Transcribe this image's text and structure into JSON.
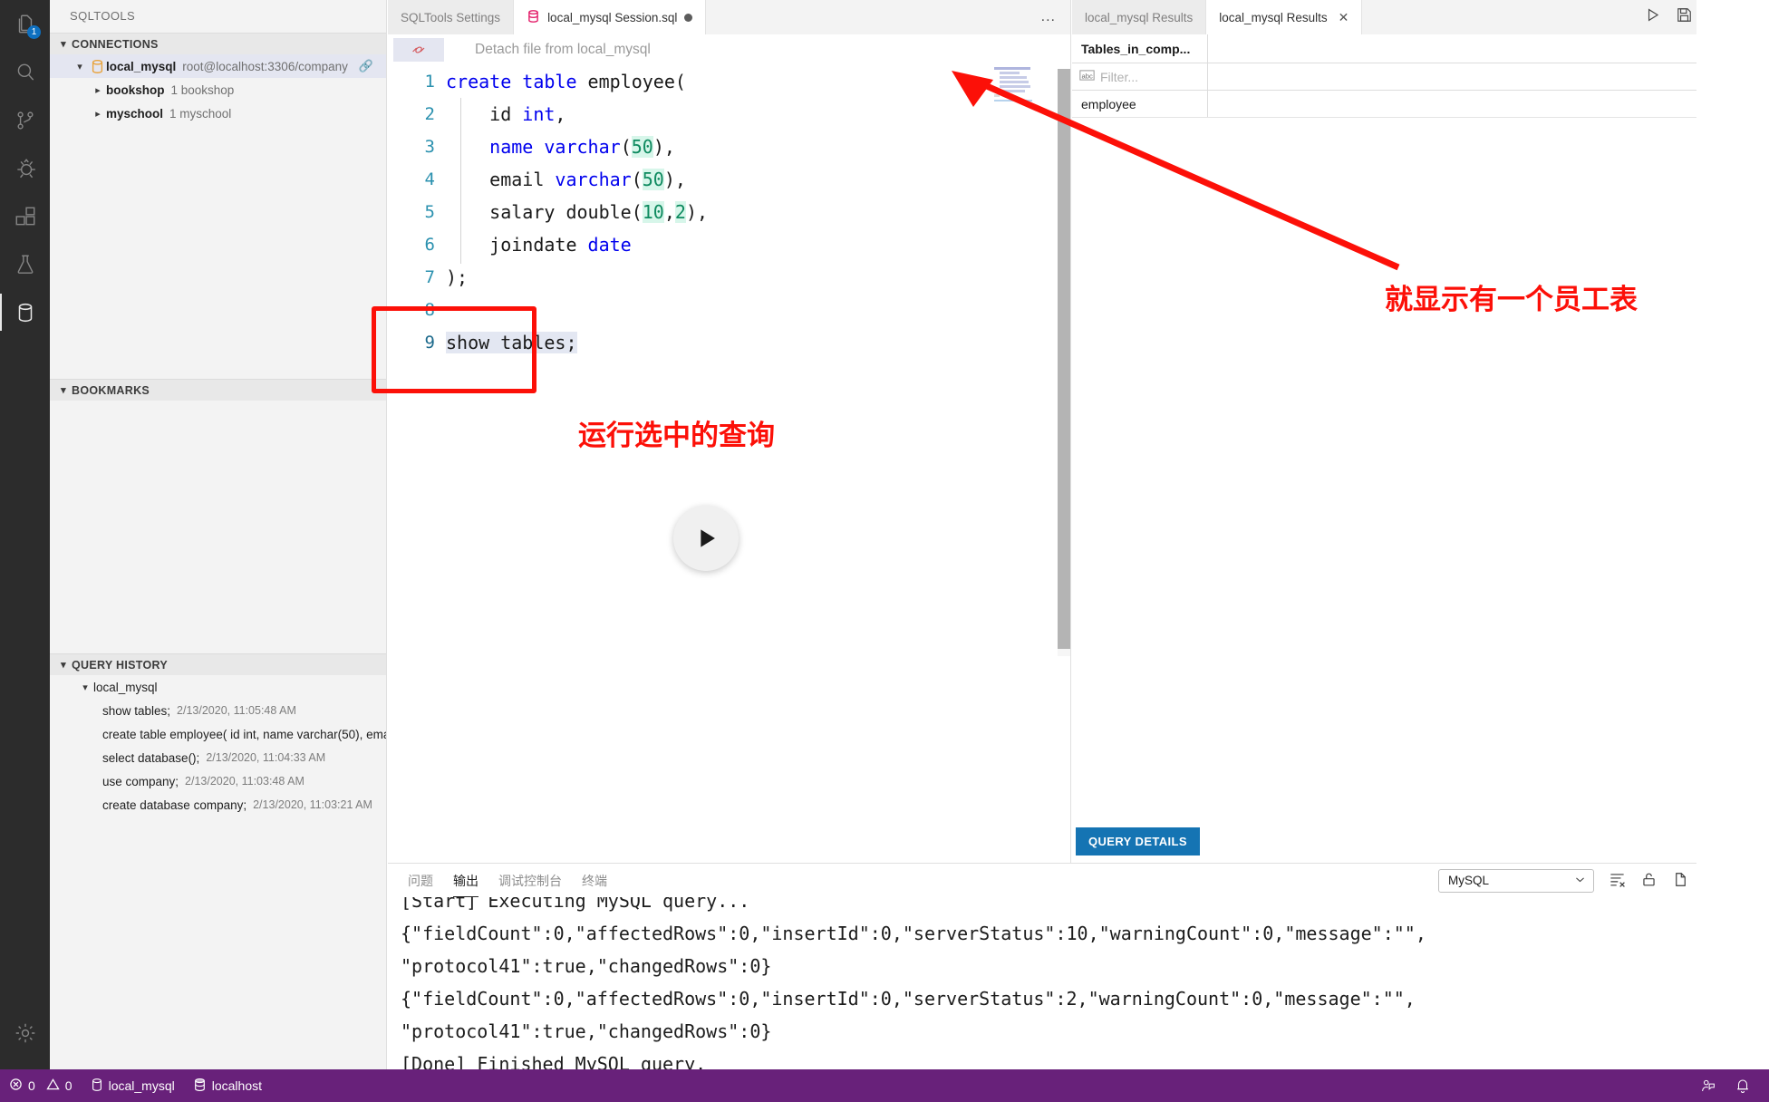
{
  "activitybar": {
    "items": [
      {
        "name": "explorer-icon",
        "badge": "1",
        "active": false
      },
      {
        "name": "search-icon",
        "badge": "",
        "active": false
      },
      {
        "name": "source-control-icon",
        "badge": "",
        "active": false
      },
      {
        "name": "run-and-debug-icon",
        "badge": "",
        "active": false
      },
      {
        "name": "extensions-icon",
        "badge": "",
        "active": false
      },
      {
        "name": "testing-icon",
        "badge": "",
        "active": false
      },
      {
        "name": "sqltools-database-icon",
        "badge": "",
        "active": true
      }
    ],
    "settings_label": "manage-gear-icon"
  },
  "sidebar": {
    "title": "SQLTOOLS",
    "connections": {
      "header": "CONNECTIONS",
      "connection": {
        "name": "local_mysql",
        "detail": "root@localhost:3306/company"
      },
      "databases": [
        {
          "name": "bookshop",
          "detail": "1 bookshop"
        },
        {
          "name": "myschool",
          "detail": "1 myschool"
        }
      ]
    },
    "bookmarks": {
      "header": "BOOKMARKS"
    },
    "query_history": {
      "header": "QUERY HISTORY",
      "group": "local_mysql",
      "items": [
        {
          "query": "show tables;",
          "time": "2/13/2020, 11:05:48 AM"
        },
        {
          "query": "create table employee( id int, name varchar(50), ema...",
          "time": ""
        },
        {
          "query": "select database();",
          "time": "2/13/2020, 11:04:33 AM"
        },
        {
          "query": "use company;",
          "time": "2/13/2020, 11:03:48 AM"
        },
        {
          "query": "create database company;",
          "time": "2/13/2020, 11:03:21 AM"
        }
      ]
    }
  },
  "editor": {
    "tabs_left": [
      {
        "label": "SQLTools Settings",
        "active": false,
        "dirty": false,
        "icon": ""
      },
      {
        "label": "local_mysql Session.sql",
        "active": true,
        "dirty": true,
        "icon": "database-icon"
      }
    ],
    "tabs_left_overflow": "...",
    "tabs_right": [
      {
        "label": "local_mysql Results",
        "active": false,
        "closable": false
      },
      {
        "label": "local_mysql Results",
        "active": true,
        "closable": true
      }
    ],
    "actions": [
      "run-icon",
      "save-icon",
      "split-editor-icon",
      "more-actions-icon"
    ],
    "codelens": "Detach file from local_mysql",
    "lines": [
      {
        "n": "1",
        "tokens": [
          {
            "t": "create",
            "c": "kw"
          },
          {
            "t": " ",
            "c": "plain"
          },
          {
            "t": "table",
            "c": "kw"
          },
          {
            "t": " employee(",
            "c": "plain"
          }
        ]
      },
      {
        "n": "2",
        "tokens": [
          {
            "t": "    id ",
            "c": "plain"
          },
          {
            "t": "int",
            "c": "kw"
          },
          {
            "t": ",",
            "c": "plain"
          }
        ]
      },
      {
        "n": "3",
        "tokens": [
          {
            "t": "    ",
            "c": "plain"
          },
          {
            "t": "name",
            "c": "kw"
          },
          {
            "t": " ",
            "c": "plain"
          },
          {
            "t": "varchar",
            "c": "kw"
          },
          {
            "t": "(",
            "c": "plain"
          },
          {
            "t": "50",
            "c": "num"
          },
          {
            "t": "),",
            "c": "plain"
          }
        ]
      },
      {
        "n": "4",
        "tokens": [
          {
            "t": "    email ",
            "c": "plain"
          },
          {
            "t": "varchar",
            "c": "kw"
          },
          {
            "t": "(",
            "c": "plain"
          },
          {
            "t": "50",
            "c": "num"
          },
          {
            "t": "),",
            "c": "plain"
          }
        ]
      },
      {
        "n": "5",
        "tokens": [
          {
            "t": "    salary double(",
            "c": "plain"
          },
          {
            "t": "10",
            "c": "num"
          },
          {
            "t": ",",
            "c": "plain"
          },
          {
            "t": "2",
            "c": "num"
          },
          {
            "t": "),",
            "c": "plain"
          }
        ]
      },
      {
        "n": "6",
        "tokens": [
          {
            "t": "    joindate ",
            "c": "plain"
          },
          {
            "t": "date",
            "c": "kw"
          }
        ]
      },
      {
        "n": "7",
        "tokens": [
          {
            "t": ");",
            "c": "plain"
          }
        ]
      },
      {
        "n": "8",
        "tokens": [
          {
            "t": "",
            "c": "plain"
          }
        ]
      },
      {
        "n": "9",
        "tokens": [
          {
            "t": "show tables;",
            "c": "plain sel"
          }
        ]
      }
    ]
  },
  "annotations": {
    "selected_query_note": "运行选中的查询",
    "result_note": "就显示有一个员工表"
  },
  "results": {
    "columns": [
      "Tables_in_comp...",
      ""
    ],
    "filter_placeholder": "Filter...",
    "rows": [
      [
        "employee",
        ""
      ]
    ],
    "query_details_label": "QUERY DETAILS"
  },
  "panel": {
    "tabs": [
      {
        "label": "问题",
        "active": false
      },
      {
        "label": "输出",
        "active": true
      },
      {
        "label": "调试控制台",
        "active": false
      },
      {
        "label": "终端",
        "active": false
      }
    ],
    "channel": "MySQL",
    "actions": [
      "clear-output-icon",
      "lock-scroll-icon",
      "open-editor-icon",
      "collapse-panel-icon",
      "close-panel-icon"
    ],
    "output_lines": [
      "[Start] Executing MySQL query...",
      "{\"fieldCount\":0,\"affectedRows\":0,\"insertId\":0,\"serverStatus\":10,\"warningCount\":0,\"message\":\"\",",
      "\"protocol41\":true,\"changedRows\":0}",
      "{\"fieldCount\":0,\"affectedRows\":0,\"insertId\":0,\"serverStatus\":2,\"warningCount\":0,\"message\":\"\",",
      "\"protocol41\":true,\"changedRows\":0}",
      "[Done] Finished MySQL query."
    ]
  },
  "statusbar": {
    "errors": "0",
    "warnings": "0",
    "connection": "local_mysql",
    "host": "localhost",
    "accent": "#68217a"
  }
}
